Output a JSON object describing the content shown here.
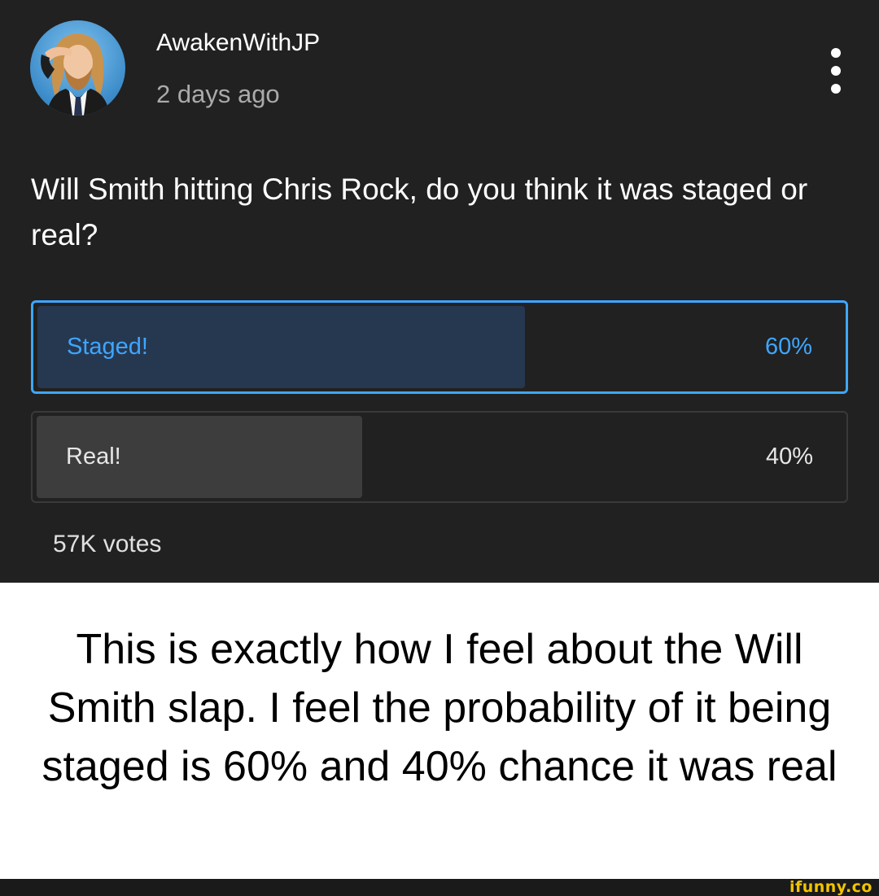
{
  "post": {
    "author": "AwakenWithJP",
    "time": "2 days ago",
    "avatar_icon": "user-avatar-icon",
    "menu_icon": "more-vertical-icon",
    "question": "Will Smith hitting Chris Rock, do you think it was staged or real?",
    "poll": {
      "options": [
        {
          "label": "Staged!",
          "percent_text": "60%",
          "percent": 60,
          "selected": true
        },
        {
          "label": "Real!",
          "percent_text": "40%",
          "percent": 40,
          "selected": false
        }
      ],
      "votes": "57K votes"
    }
  },
  "caption": "This is exactly how I feel about the Will Smith slap. I feel the probability of it being staged is 60% and 40% chance it was real",
  "watermark": "ifunny.co",
  "colors": {
    "background_dark": "#212121",
    "accent_blue": "#3ea6ff",
    "selected_fill": "#263850",
    "other_fill": "#3d3d3d",
    "watermark_yellow": "#f2c400"
  }
}
